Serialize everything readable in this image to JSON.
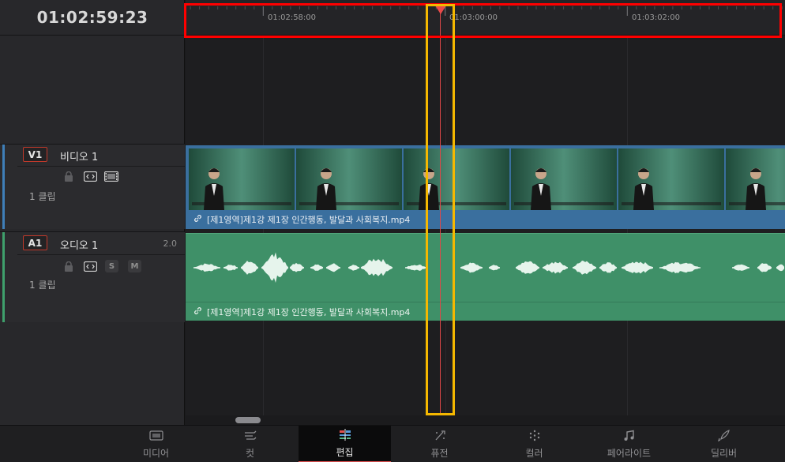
{
  "timecode": "01:02:59:23",
  "ruler": {
    "labels": [
      "01:02:58:00",
      "01:03:00:00",
      "01:03:02:00"
    ]
  },
  "tracks": {
    "video": {
      "id": "V1",
      "name": "비디오 1",
      "clip_count": "1 클립",
      "color": "#3f7fb8"
    },
    "audio": {
      "id": "A1",
      "name": "오디오 1",
      "level": "2.0",
      "clip_count": "1 클립",
      "solo_label": "S",
      "mute_label": "M",
      "color": "#3fa06c"
    }
  },
  "clips": {
    "video": {
      "filename": "[제1영역]제1강 제1장 인간행동, 발달과 사회복지.mp4"
    },
    "audio": {
      "filename": "[제1영역]제1강 제1장 인간행동, 발달과 사회복지.mp4"
    }
  },
  "pages": [
    {
      "label": "미디어",
      "icon": "media-icon",
      "active": false
    },
    {
      "label": "컷",
      "icon": "cut-icon",
      "active": false
    },
    {
      "label": "편집",
      "icon": "edit-icon",
      "active": true
    },
    {
      "label": "퓨전",
      "icon": "fusion-icon",
      "active": false
    },
    {
      "label": "컬러",
      "icon": "color-icon",
      "active": false
    },
    {
      "label": "페어라이트",
      "icon": "fairlight-icon",
      "active": false
    },
    {
      "label": "딜리버",
      "icon": "deliver-icon",
      "active": false
    }
  ],
  "colors": {
    "playhead": "#e04848",
    "highlight_ruler": "#ff0000",
    "highlight_playhead": "#f5b800",
    "video_clip": "#3a6f9e",
    "audio_clip": "#3f9068"
  }
}
